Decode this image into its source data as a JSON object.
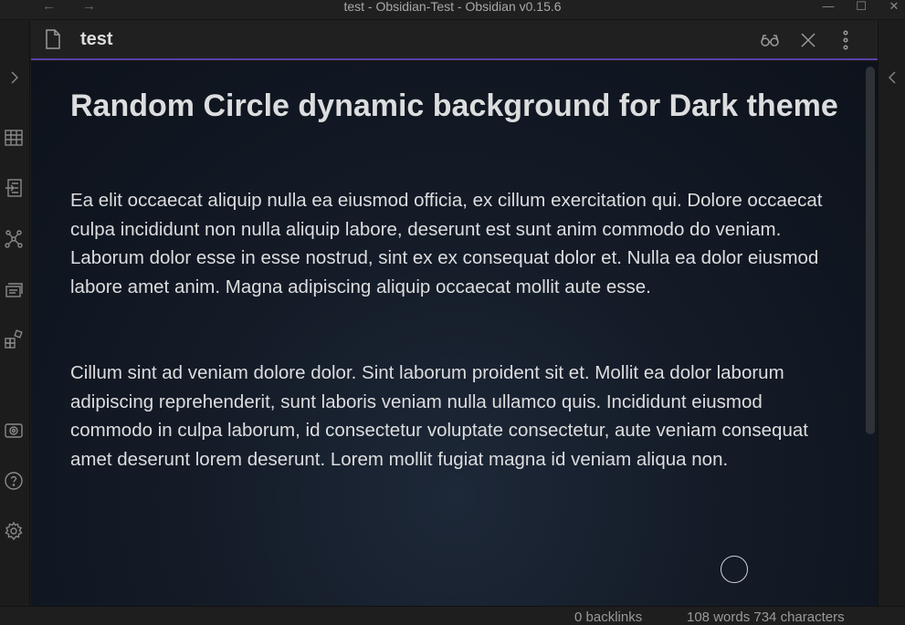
{
  "window": {
    "title": "test - Obsidian-Test - Obsidian v0.15.6",
    "back_glyph": "←",
    "forward_glyph": "→",
    "minimize_glyph": "—",
    "maximize_glyph": "☐",
    "close_glyph": "✕"
  },
  "ribbon": {
    "icons": [
      "expand-chevron-icon",
      "table-icon",
      "import-icon",
      "graph-icon",
      "cards-icon",
      "plugins-icon",
      "vault-icon",
      "help-icon",
      "settings-icon"
    ]
  },
  "view": {
    "title": "test",
    "actions": [
      "reading-view-icon",
      "close-icon",
      "more-options-icon"
    ]
  },
  "note": {
    "heading": "Random Circle dynamic background for Dark theme",
    "paragraphs": [
      "Ea elit occaecat aliquip nulla ea eiusmod officia, ex cillum exercitation qui. Dolore occaecat culpa incididunt non nulla aliquip labore, deserunt est sunt anim commodo do veniam. Laborum dolor esse in esse nostrud, sint ex ex consequat dolor et. Nulla ea dolor eiusmod labore amet anim. Magna adipiscing aliquip occaecat mollit aute esse.",
      "Cillum sint ad veniam dolore dolor. Sint laborum proident sit et. Mollit ea dolor laborum adipiscing reprehenderit, sunt laboris veniam nulla ullamco quis. Incididunt eiusmod commodo in culpa laborum, id consectetur voluptate consectetur, aute veniam consequat amet deserunt lorem deserunt. Lorem mollit fugiat magna id veniam aliqua non."
    ]
  },
  "status": {
    "backlinks": "0 backlinks",
    "counts": "108 words  734 characters"
  },
  "colors": {
    "accent": "#5b3fa8",
    "background": "#1e1e1e",
    "text": "#dcddde"
  }
}
